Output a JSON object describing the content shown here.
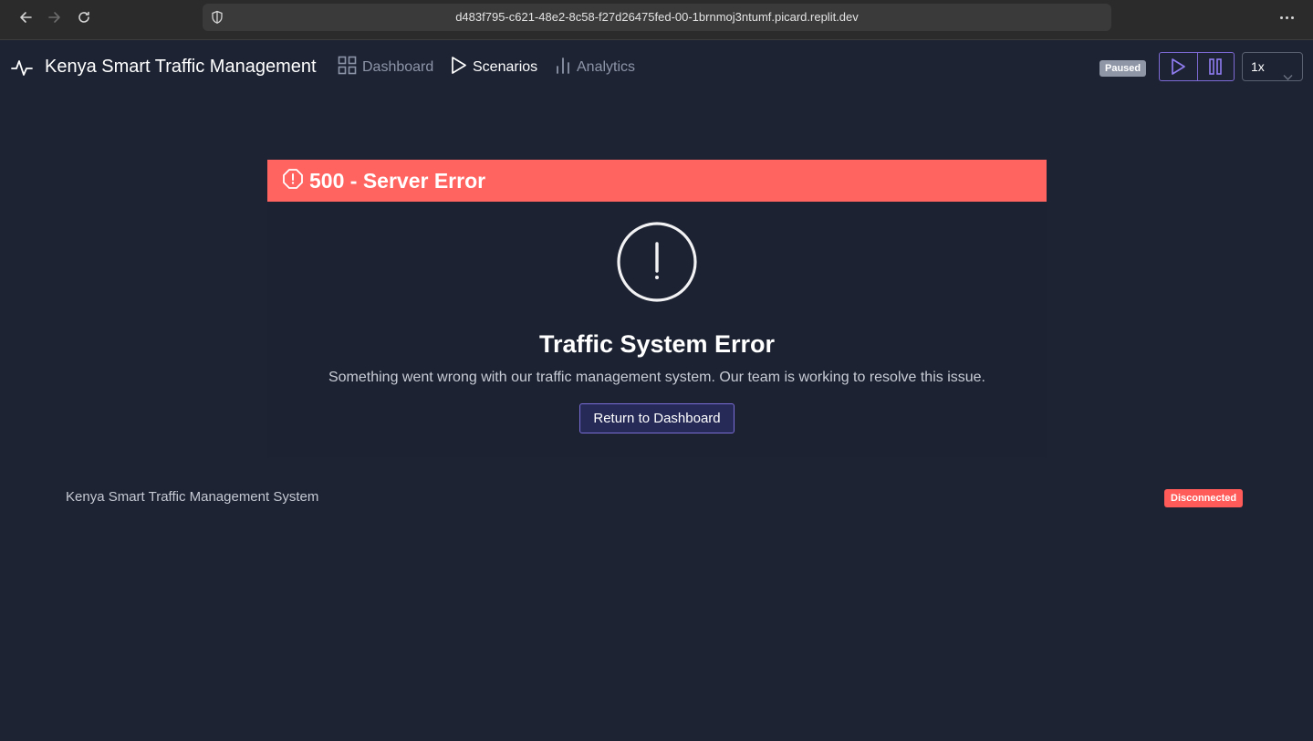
{
  "browser": {
    "url": "d483f795-c621-48e2-8c58-f27d26475fed-00-1brnmoj3ntumf.picard.replit.dev",
    "icons": [
      "back-arrow-icon",
      "forward-arrow-icon",
      "reload-icon",
      "shield-icon",
      "more-horizontal-icon"
    ]
  },
  "header": {
    "title": "Kenya Smart Traffic Management",
    "nav": [
      {
        "label": "Dashboard",
        "icon": "grid-icon",
        "active": false
      },
      {
        "label": "Scenarios",
        "icon": "play-outline-icon",
        "active": true
      },
      {
        "label": "Analytics",
        "icon": "bar-chart-icon",
        "active": false
      }
    ],
    "status_badge": "Paused",
    "speed": "1x"
  },
  "error": {
    "banner_title": "500 - Server Error",
    "heading": "Traffic System Error",
    "message": "Something went wrong with our traffic management system. Our team is working to resolve this issue.",
    "button_label": "Return to Dashboard"
  },
  "footer": {
    "text": "Kenya Smart Traffic Management System",
    "connection_status": "Disconnected"
  },
  "colors": {
    "background": "#1d2333",
    "error_banner": "#ff6461",
    "accent": "#7b6dd8",
    "paused_badge": "#8f96a6",
    "disconnected_badge": "#ff5b58"
  }
}
